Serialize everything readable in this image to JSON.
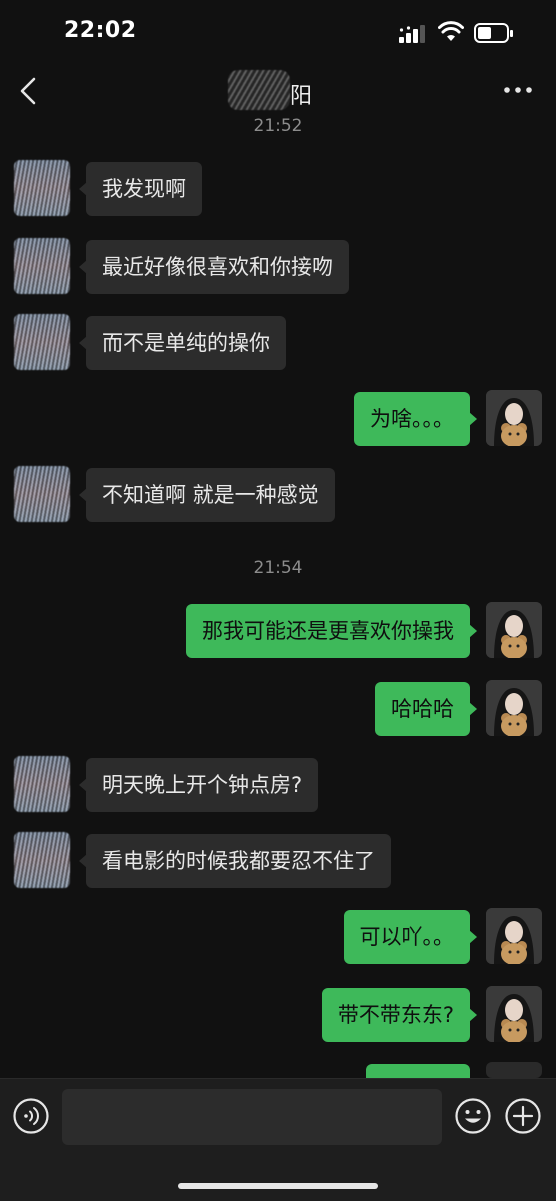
{
  "status_bar": {
    "time": "22:02"
  },
  "header": {
    "title_visible_char": "阳"
  },
  "timestamps": [
    "21:52",
    "21:54"
  ],
  "messages": [
    {
      "side": "left",
      "text": "我发现啊"
    },
    {
      "side": "left",
      "text": "最近好像很喜欢和你接吻"
    },
    {
      "side": "left",
      "text": "而不是单纯的操你"
    },
    {
      "side": "right",
      "text": "为啥。。。"
    },
    {
      "side": "left",
      "text": "不知道啊 就是一种感觉"
    },
    {
      "side": "right",
      "text": "那我可能还是更喜欢你操我"
    },
    {
      "side": "right",
      "text": "哈哈哈"
    },
    {
      "side": "left",
      "text": "明天晚上开个钟点房?"
    },
    {
      "side": "left",
      "text": "看电影的时候我都要忍不住了"
    },
    {
      "side": "right",
      "text": "可以吖。。"
    },
    {
      "side": "right",
      "text": "带不带东东?"
    }
  ],
  "input": {
    "placeholder": ""
  },
  "colors": {
    "background": "#111111",
    "bubble_incoming": "#2c2c2c",
    "bubble_outgoing": "#3eb95a",
    "timestamp": "#8c8c8c"
  },
  "icons": [
    "back-icon",
    "more-icon",
    "voice-icon",
    "emoji-icon",
    "plus-icon",
    "signal-icon",
    "wifi-icon",
    "battery-icon"
  ]
}
